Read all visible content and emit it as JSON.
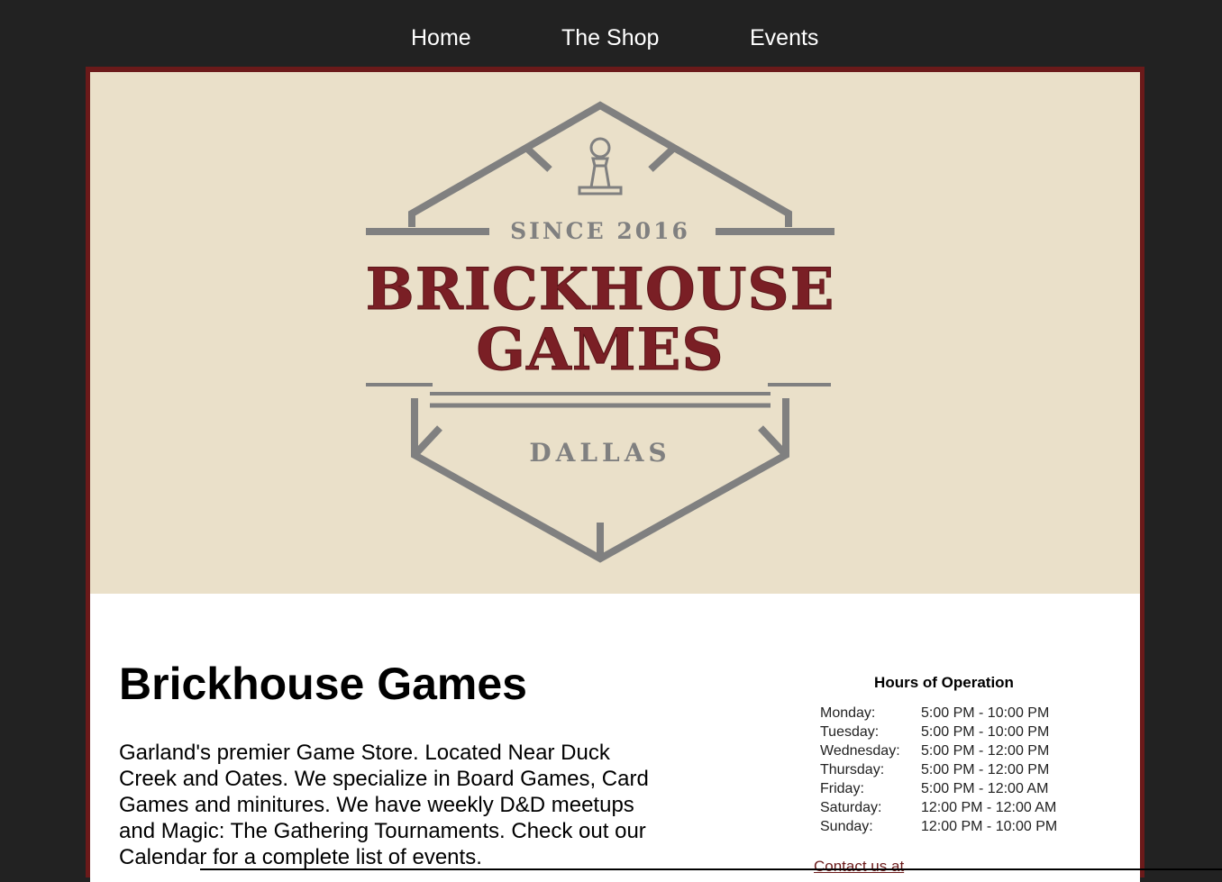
{
  "nav": {
    "items": [
      {
        "label": "Home"
      },
      {
        "label": "The Shop"
      },
      {
        "label": "Events"
      }
    ]
  },
  "logo": {
    "since": "SINCE 2016",
    "line1": "BRICKHOUSE",
    "line2": "GAMES",
    "city": "DALLAS",
    "icon": "chess-pawn-icon"
  },
  "main": {
    "title": "Brickhouse Games",
    "description": "Garland's premier Game Store. Located Near Duck Creek and Oates. We specialize in Board Games, Card Games and minitures. We have weekly D&D meetups and Magic: The Gathering Tournaments. Check out our Calendar for a complete list of events."
  },
  "hours": {
    "title": "Hours of Operation",
    "rows": [
      {
        "day": "Monday:",
        "time": "5:00 PM - 10:00 PM"
      },
      {
        "day": "Tuesday:",
        "time": "5:00 PM - 10:00 PM"
      },
      {
        "day": "Wednesday:",
        "time": "5:00 PM - 12:00 PM"
      },
      {
        "day": "Thursday:",
        "time": "5:00 PM - 12:00 PM"
      },
      {
        "day": "Friday:",
        "time": "5:00 PM - 12:00 AM"
      },
      {
        "day": "Saturday:",
        "time": "12:00 PM - 12:00 AM"
      },
      {
        "day": "Sunday:",
        "time": "12:00 PM - 10:00 PM"
      }
    ]
  },
  "contact": {
    "label": "Contact us at"
  },
  "colors": {
    "background": "#222222",
    "banner": "#eae0c9",
    "brand_red": "#7a1f25",
    "logo_gray": "#808080",
    "frame": "#6b1a1a"
  }
}
